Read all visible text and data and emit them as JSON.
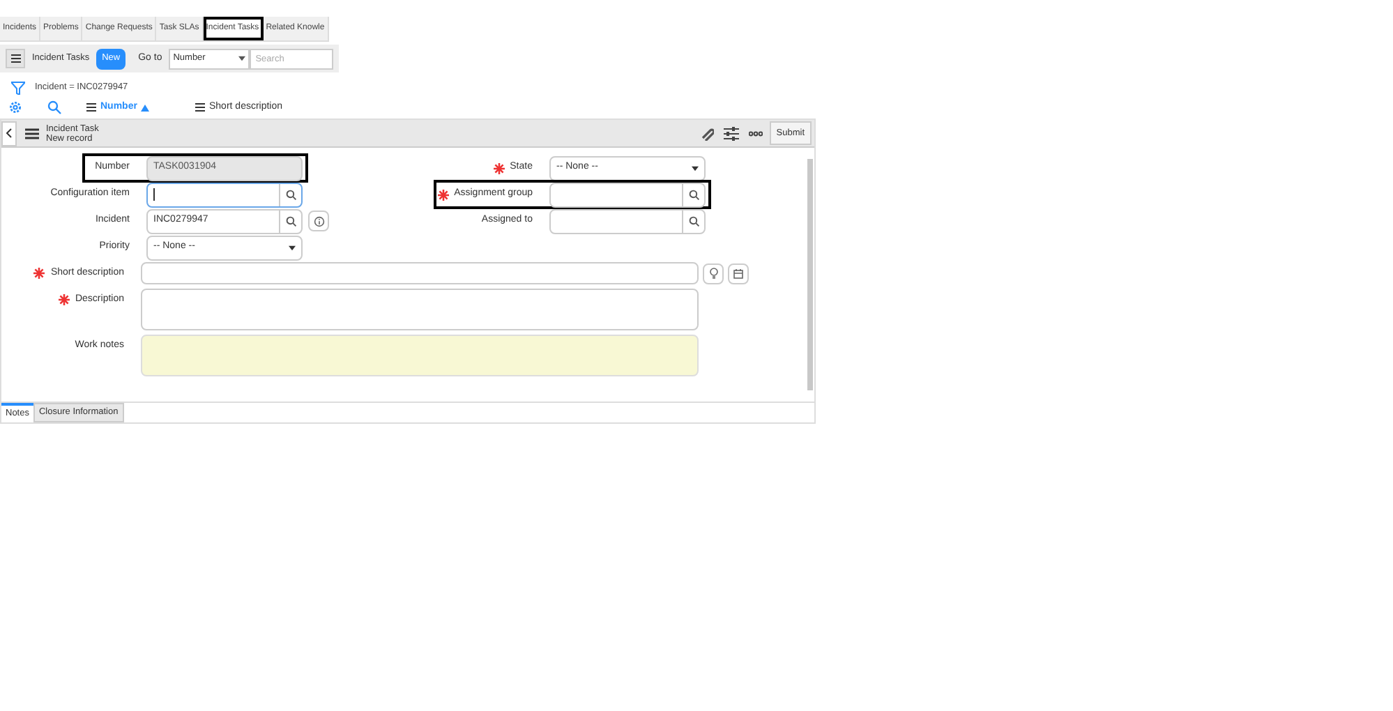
{
  "related_tabs": [
    {
      "label": "Incidents",
      "selected": false,
      "highlighted": false
    },
    {
      "label": "Problems",
      "selected": false,
      "highlighted": false
    },
    {
      "label": "Change Requests",
      "selected": false,
      "highlighted": false
    },
    {
      "label": "Task SLAs",
      "selected": false,
      "highlighted": false
    },
    {
      "label": "Incident Tasks",
      "selected": true,
      "highlighted": true
    },
    {
      "label": "Related Knowle",
      "selected": false,
      "highlighted": false
    }
  ],
  "list_toolbar": {
    "title": "Incident Tasks",
    "new_button": "New",
    "goto_label": "Go to",
    "goto_field": "Number",
    "search_placeholder": "Search"
  },
  "filter": "Incident = INC0279947",
  "columns": [
    {
      "label": "Number",
      "sorted": true
    },
    {
      "label": "Short description",
      "sorted": false
    }
  ],
  "form": {
    "title": "Incident Task",
    "subtitle": "New record",
    "submit": "Submit",
    "left_fields": [
      {
        "label": "Number",
        "kind": "readonly",
        "value": "TASK0031904",
        "mandatory": false,
        "highlighted": true,
        "focused": false
      },
      {
        "label": "Configuration item",
        "kind": "reference",
        "mandatory": false,
        "highlighted": false,
        "focused": true
      },
      {
        "label": "Incident",
        "kind": "reference",
        "value": "INC0279947",
        "info": true,
        "mandatory": false,
        "highlighted": false,
        "focused": false
      },
      {
        "label": "Priority",
        "kind": "select",
        "value": "-- None --",
        "mandatory": false,
        "highlighted": false,
        "focused": false
      }
    ],
    "right_fields": [
      {
        "label": "State",
        "kind": "select",
        "value": "-- None --",
        "mandatory": true,
        "highlighted": false,
        "focused": false
      },
      {
        "label": "Assignment group",
        "kind": "reference",
        "mandatory": true,
        "highlighted": true,
        "focused": false
      },
      {
        "label": "Assigned to",
        "kind": "reference",
        "mandatory": false,
        "highlighted": false,
        "focused": false
      }
    ],
    "wide_fields": [
      {
        "label": "Short description",
        "kind": "text",
        "mandatory": true
      },
      {
        "label": "Description",
        "kind": "textarea",
        "mandatory": true
      },
      {
        "label": "Work notes",
        "kind": "journal",
        "mandatory": false
      }
    ],
    "section_tabs": [
      {
        "label": "Notes",
        "selected": true
      },
      {
        "label": "Closure Information",
        "selected": false
      }
    ]
  }
}
